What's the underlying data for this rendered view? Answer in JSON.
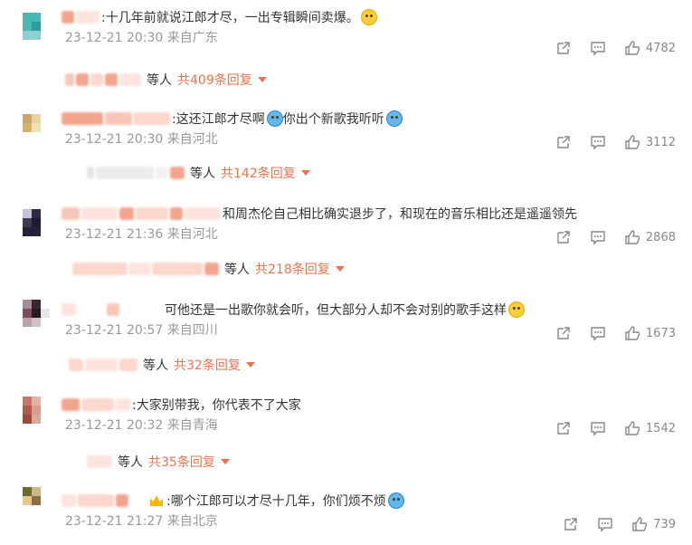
{
  "comments": [
    {
      "text": ":十几年前就说江郎才尽，一出专辑瞬间卖爆。",
      "time": "23-12-21 20:30",
      "location": "来自广东",
      "likes": "4782",
      "reply_who": "等人",
      "reply_more": "共409条回复",
      "emoji": "smile-emoji",
      "avatar": [
        "#4ab8b2",
        "#4ab8b2",
        "#fff",
        "#4ab8b2",
        "#2e9c9a",
        "#fff",
        "#8ed1cf",
        "#8ed1cf",
        "#fff"
      ]
    },
    {
      "text": ":这还江郎才尽啊",
      "text2": "你出个新歌我听听",
      "time": "23-12-21 20:30",
      "location": "来自河北",
      "likes": "3112",
      "reply_who": "等人",
      "reply_more": "共142条回复",
      "emoji": "laugh-cry-emoji",
      "avatar": [
        "#c9a86a",
        "#e8d3a3",
        "#fff",
        "#d6b36a",
        "#f0e2b8",
        "#fff",
        "#fff",
        "#fff",
        "#fff"
      ]
    },
    {
      "text": "和周杰伦自己相比确实退步了，和现在的音乐相比还是遥遥领先",
      "time": "23-12-21 21:36",
      "location": "来自河北",
      "likes": "2868",
      "reply_who": "等人",
      "reply_more": "共218条回复",
      "avatar": [
        "#c2c2d6",
        "#2b2b44",
        "#fff",
        "#3b3a56",
        "#1c1c33",
        "#fff",
        "#222238",
        "#222238",
        "#fff"
      ]
    },
    {
      "text": "可他还是一出歌你就会听，但大部分人却不会对别的歌手这样",
      "time": "23-12-21 20:57",
      "location": "来自四川",
      "likes": "1673",
      "reply_who": "等人",
      "reply_more": "共32条回复",
      "emoji": "think-emoji",
      "avatar": [
        "#a58d98",
        "#3a2530",
        "#fff",
        "#7a4d5e",
        "#2a1a22",
        "#e6e6e6",
        "#b8a3ad",
        "#cfc2c8",
        "#fff"
      ]
    },
    {
      "text": ":大家别带我，你代表不了大家",
      "time": "23-12-21 20:32",
      "location": "来自青海",
      "likes": "1542",
      "reply_who": "等人",
      "reply_more": "共35条回复",
      "avatar": [
        "#c9766a",
        "#e3b3a6",
        "#fff",
        "#b15a4e",
        "#d79e8f",
        "#fff",
        "#9d4a3e",
        "#d7aa9d",
        "#fff"
      ]
    },
    {
      "text": ":哪个江郎可以才尽十几年，你们烦不烦",
      "time": "23-12-21 21:27",
      "location": "来自北京",
      "likes": "739",
      "emoji": "sweat-emoji",
      "avatar": [
        "#6f6a2a",
        "#c9b98a",
        "#fff",
        "#e6c88f",
        "#8d6d48",
        "#fff",
        "#fff",
        "#fff",
        "#fff"
      ]
    }
  ]
}
